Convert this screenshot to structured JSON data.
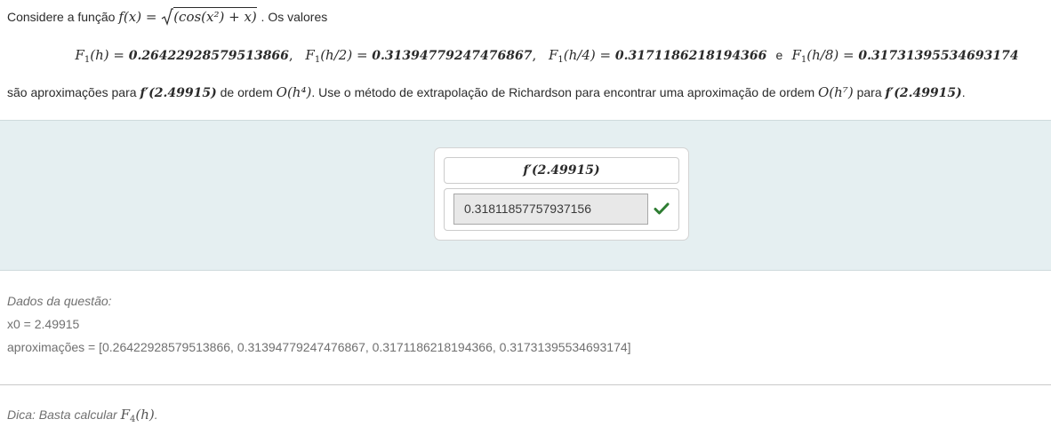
{
  "question": {
    "intro_prefix": "Considere a função",
    "func_name": "f",
    "func_var": "x",
    "func_body": "(cos(x²) + x)",
    "intro_suffix": ". Os valores",
    "approximations": [
      {
        "label": "F",
        "index": "1",
        "arg": "(h)",
        "value": "0.26422928579513866"
      },
      {
        "label": "F",
        "index": "1",
        "arg": "(h/2)",
        "value": "0.31394779247476867"
      },
      {
        "label": "F",
        "index": "1",
        "arg": "(h/4)",
        "value": "0.3171186218194366"
      },
      {
        "label": "F",
        "index": "1",
        "arg": "(h/8)",
        "value": "0.31731395534693174"
      }
    ],
    "conjunction": "e",
    "task_prefix": "são aproximações para",
    "derivative_expr": "f′(2.49915)",
    "task_order_text": "de ordem",
    "order_given": "O(h⁴)",
    "task_middle": ". Use o método de extrapolação de Richardson para encontrar uma aproximação de ordem",
    "order_target": "O(h⁷)",
    "task_for": "para",
    "task_end": "."
  },
  "answer": {
    "label": "f′(2.49915)",
    "value": "0.31811857757937156",
    "status_icon": "check-icon",
    "status_color": "#2e7d32"
  },
  "data": {
    "title": "Dados da questão:",
    "x0": "x0 = 2.49915",
    "approximations": "aproximações = [0.26422928579513866, 0.31394779247476867, 0.3171186218194366, 0.31731395534693174]"
  },
  "hint": {
    "prefix": "Dica: Basta calcular",
    "label": "F",
    "index": "4",
    "arg": "(h)",
    "suffix": "."
  }
}
